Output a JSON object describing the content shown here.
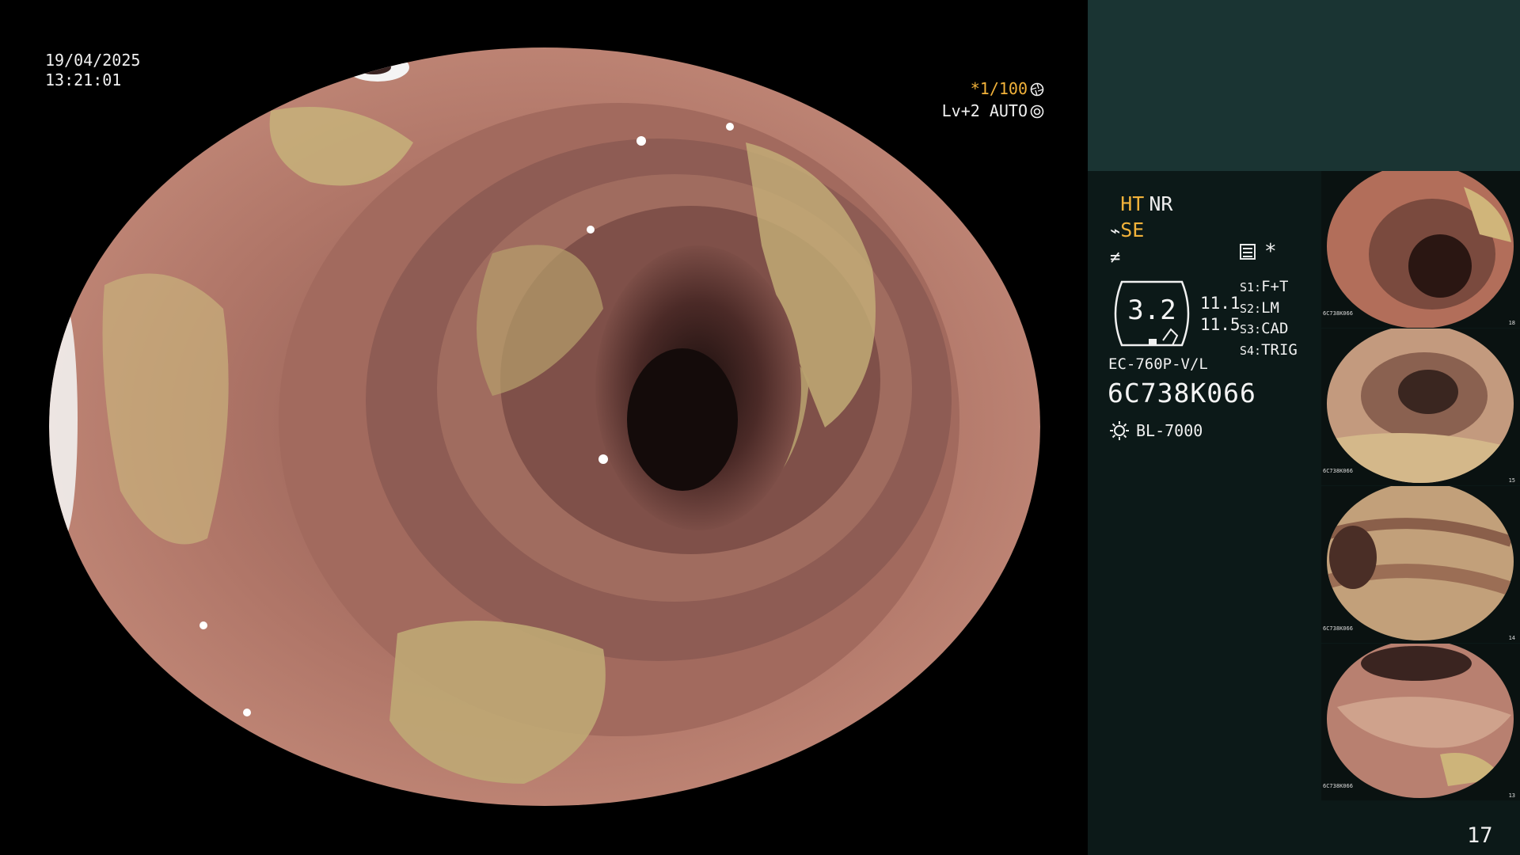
{
  "overlay": {
    "date": "19/04/2025",
    "time": "13:21:01",
    "shutter": "*1/100",
    "level": "Lv+2 AUTO"
  },
  "panel": {
    "mode_ht": "HT",
    "mode_nr": "NR",
    "mode_se": "SE",
    "gauge_value": "3.2",
    "gauge_nums": [
      "11.1",
      "11.5"
    ],
    "slots": [
      {
        "key": "S1:",
        "value": "F+T"
      },
      {
        "key": "S2:",
        "value": "LM"
      },
      {
        "key": "S3:",
        "value": "CAD"
      },
      {
        "key": "S4:",
        "value": "TRIG"
      }
    ],
    "scope_model": "EC-760P-V/L",
    "scope_serial": "6C738K066",
    "light_source": "BL-7000",
    "page_number": "17"
  },
  "thumbnails": [
    {
      "caption": "6C738K066",
      "number": "18"
    },
    {
      "caption": "6C738K066",
      "number": "15"
    },
    {
      "caption": "6C738K066",
      "number": "14"
    },
    {
      "caption": "6C738K066",
      "number": "13"
    }
  ],
  "colors": {
    "accent": "#f2b23a",
    "panel_bg": "#0c1918",
    "panel_top_bg": "#1a3433",
    "tissue": "#a56a5e",
    "coating": "#c8b47a"
  },
  "icons": [
    "aperture-icon",
    "auto-icon",
    "settings-box-icon",
    "sun-icon",
    "scope-icon"
  ]
}
